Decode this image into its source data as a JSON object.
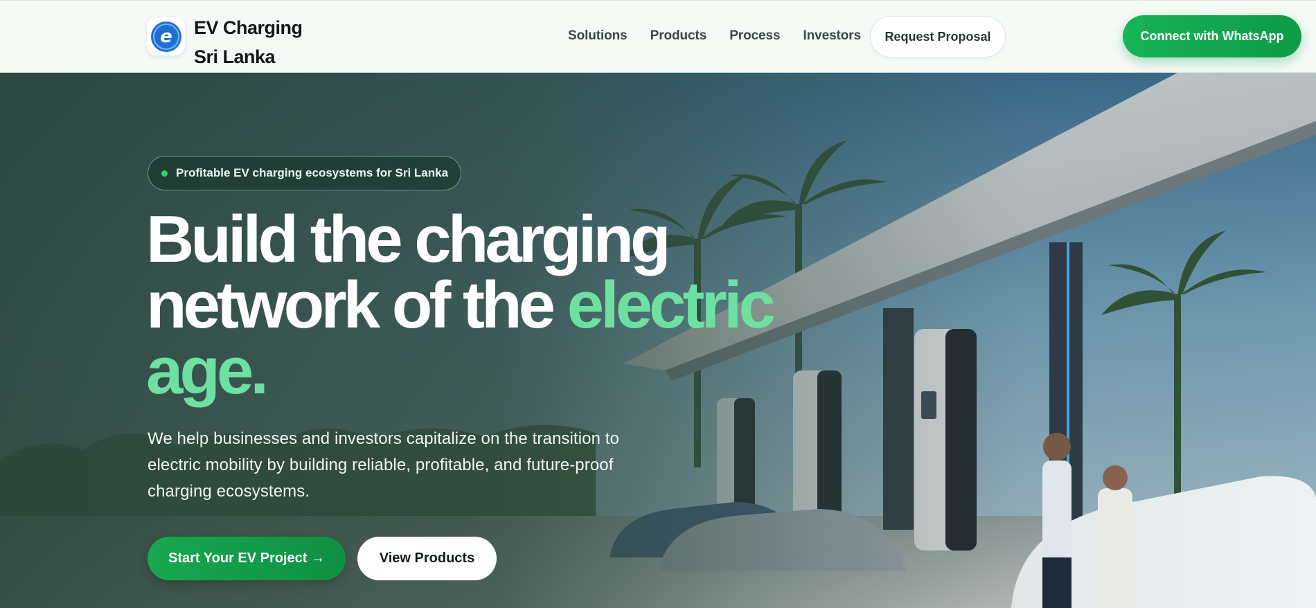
{
  "brand": {
    "name_line1": "EV Charging",
    "name_line2": "Sri Lanka",
    "logo_letter": "e"
  },
  "nav": {
    "items": [
      {
        "label": "Solutions"
      },
      {
        "label": "Products"
      },
      {
        "label": "Process"
      },
      {
        "label": "Investors"
      }
    ],
    "request_label": "Request Proposal",
    "whatsapp_label": "Connect with WhatsApp"
  },
  "hero": {
    "badge": "Profitable EV charging ecosystems for Sri Lanka",
    "headline_part1": "Build the charging network of the ",
    "headline_accent": "electric age.",
    "subtext": "We help businesses and investors capitalize on the transition to electric mobility by building reliable, profitable, and future-proof charging ecosystems.",
    "cta_primary": "Start Your EV Project →",
    "cta_secondary": "View Products"
  },
  "colors": {
    "brand_green": "#16b457",
    "accent_green": "#6ee0a2",
    "logo_blue": "#1f6fd1"
  }
}
